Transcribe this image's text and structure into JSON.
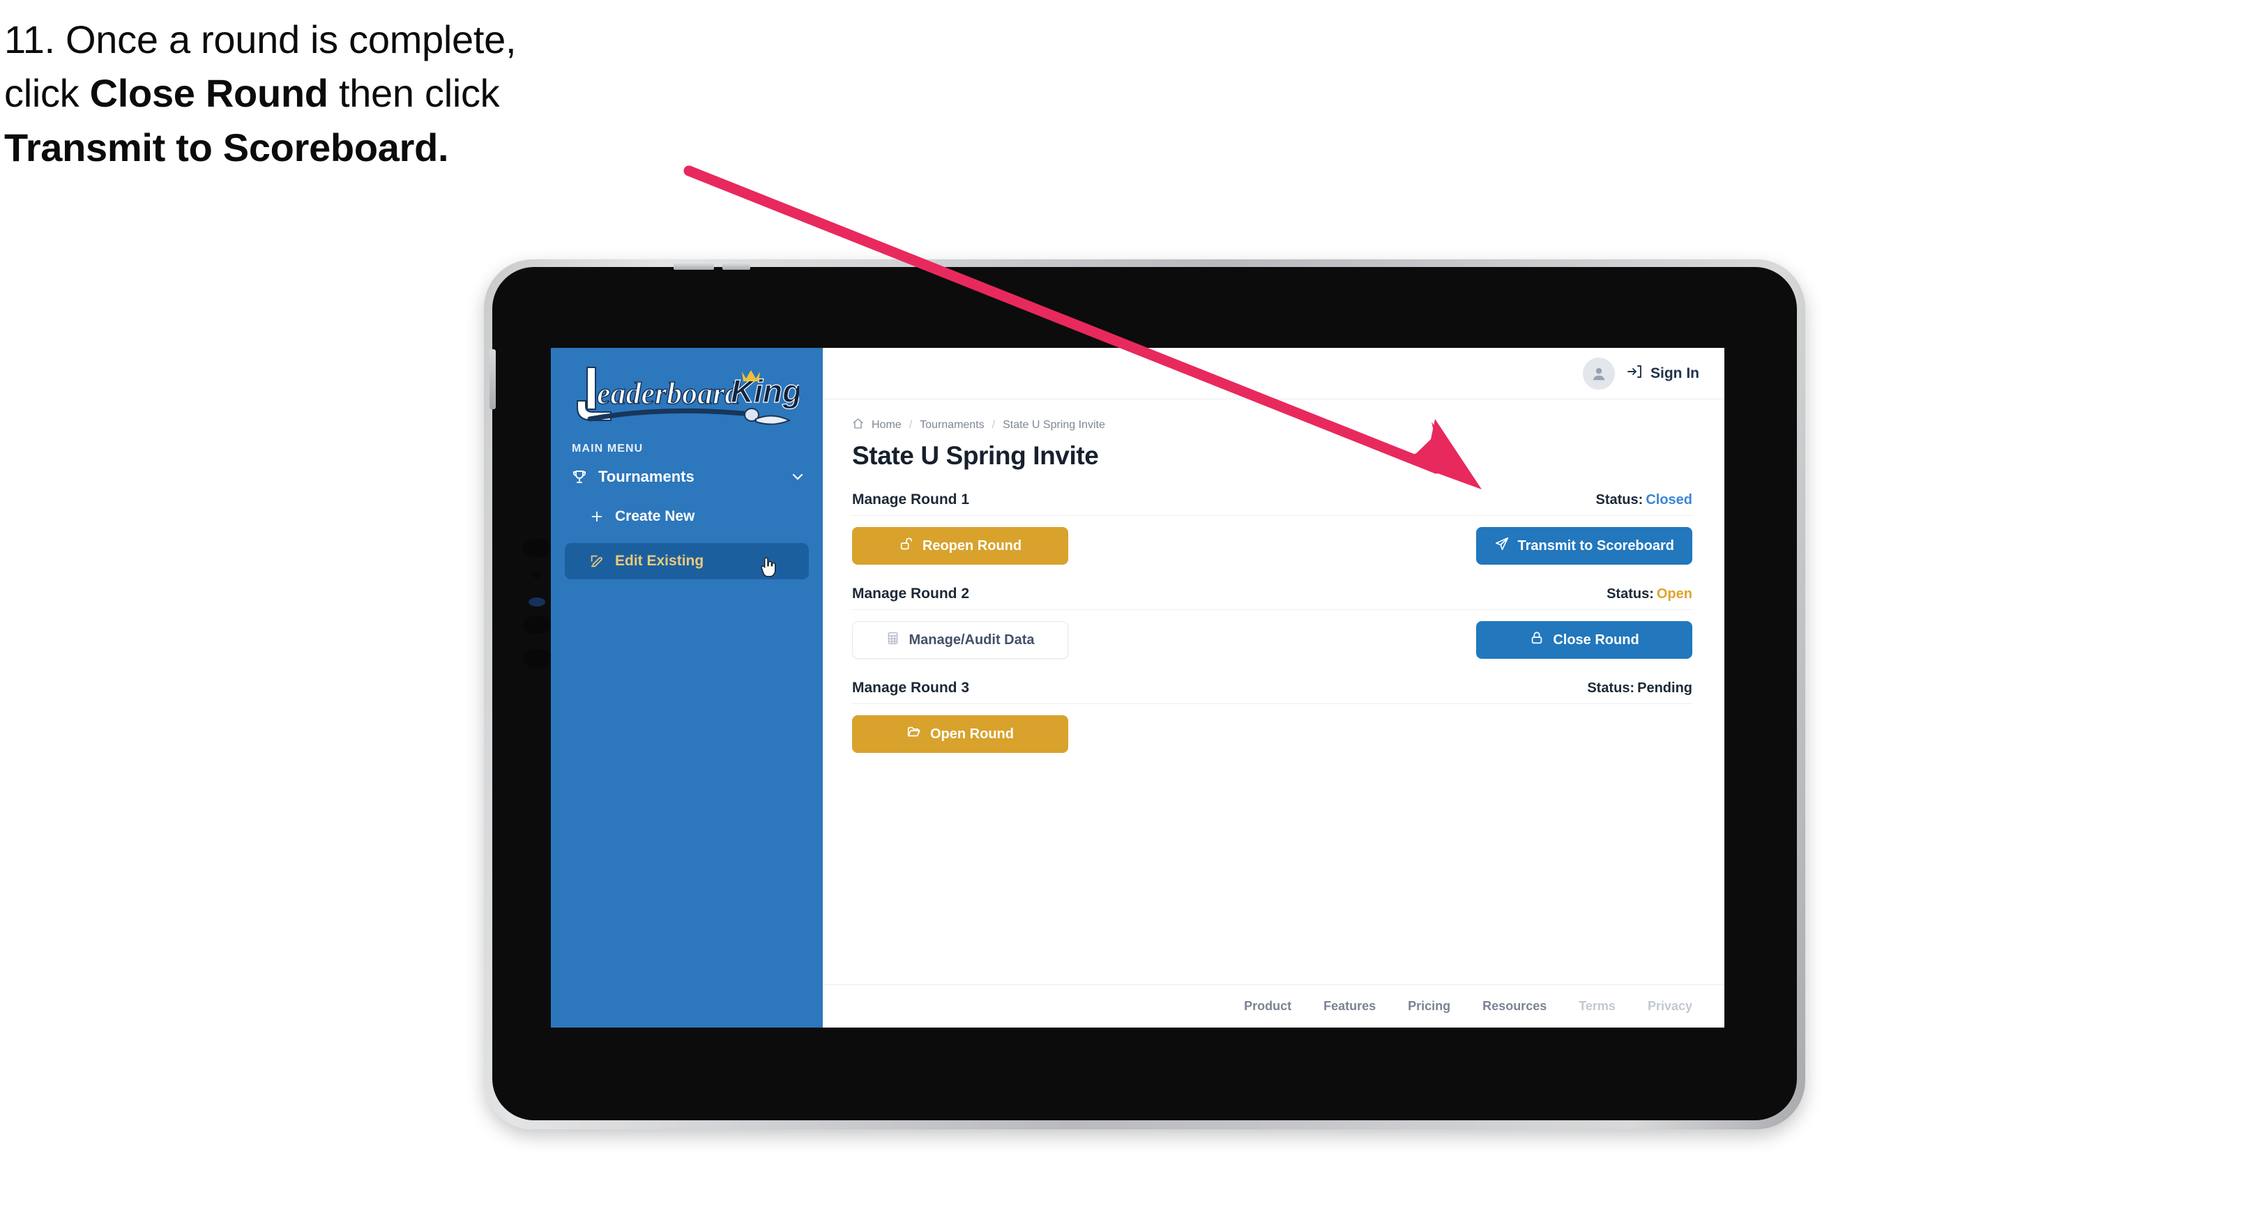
{
  "caption": {
    "line1_plain": "11. Once a round is complete,",
    "line2_pre": "click ",
    "line2_bold": "Close Round",
    "line2_post": " then click",
    "line3_bold": "Transmit to Scoreboard."
  },
  "colors": {
    "sidebar_blue": "#2d77bc",
    "sidebar_active_blue": "#1c5f9f",
    "sidebar_active_text": "#e9c97c",
    "gold_button": "#d8a22c",
    "blue_button": "#2277bd",
    "status_closed": "#3a86d6",
    "status_open": "#e0a42b",
    "arrow_pink": "#e8295e"
  },
  "sidebar": {
    "logo_word_1": "Leaderboard",
    "logo_word_2": "King",
    "menu_label": "MAIN MENU",
    "items": [
      {
        "label": "Tournaments",
        "icon": "trophy-icon",
        "chevron": "chevron-down-icon"
      },
      {
        "label": "Create New",
        "icon": "plus-icon",
        "active": false
      },
      {
        "label": "Edit Existing",
        "icon": "edit-pencil-icon",
        "active": true
      }
    ]
  },
  "topbar": {
    "avatar_icon": "user-avatar-icon",
    "signin_icon": "sign-in-arrow-icon",
    "signin_label": "Sign In"
  },
  "breadcrumb": {
    "home_icon": "home-icon",
    "items": [
      "Home",
      "Tournaments",
      "State U Spring Invite"
    ],
    "separator": "/"
  },
  "page": {
    "title": "State U Spring Invite"
  },
  "rounds": [
    {
      "title": "Manage Round 1",
      "status_label": "Status:",
      "status_value": "Closed",
      "status_class": "closed",
      "left_button": {
        "label": "Reopen Round",
        "style": "gold",
        "icon": "unlock-icon"
      },
      "right_button": {
        "label": "Transmit to Scoreboard",
        "style": "blue",
        "icon": "send-paper-plane-icon"
      }
    },
    {
      "title": "Manage Round 2",
      "status_label": "Status:",
      "status_value": "Open",
      "status_class": "open",
      "left_button": {
        "label": "Manage/Audit Data",
        "style": "ghost",
        "icon": "table-grid-icon"
      },
      "right_button": {
        "label": "Close Round",
        "style": "blue",
        "icon": "lock-icon"
      }
    },
    {
      "title": "Manage Round 3",
      "status_label": "Status:",
      "status_value": "Pending",
      "status_class": "pending",
      "left_button": {
        "label": "Open Round",
        "style": "gold",
        "icon": "folder-open-icon"
      },
      "right_button": null
    }
  ],
  "footer": {
    "links": [
      {
        "label": "Product",
        "dim": false
      },
      {
        "label": "Features",
        "dim": false
      },
      {
        "label": "Pricing",
        "dim": false
      },
      {
        "label": "Resources",
        "dim": false
      },
      {
        "label": "Terms",
        "dim": true
      },
      {
        "label": "Privacy",
        "dim": true
      }
    ]
  }
}
